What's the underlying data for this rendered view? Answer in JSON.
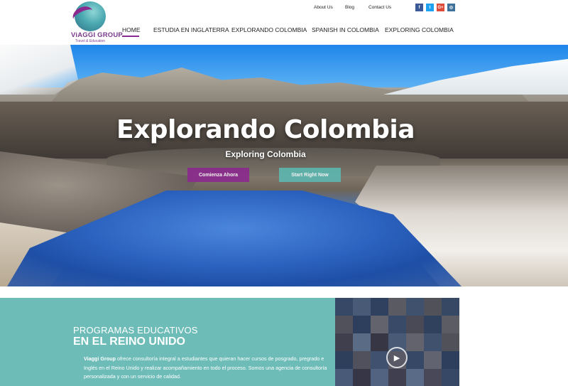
{
  "brand": {
    "name": "ViAGGI GROUP",
    "tagline": "Travel & Education"
  },
  "top_links": [
    "About Us",
    "Blog",
    "Contact Us"
  ],
  "social": [
    {
      "icon": "facebook-icon",
      "glyph": "f",
      "color": "#3b5998"
    },
    {
      "icon": "twitter-icon",
      "glyph": "t",
      "color": "#1da1f2"
    },
    {
      "icon": "google-plus-icon",
      "glyph": "G+",
      "color": "#dd4b39"
    },
    {
      "icon": "instagram-icon",
      "glyph": "◎",
      "color": "#3f729b"
    }
  ],
  "nav": [
    "HOME",
    "ESTUDIA EN INGLATERRA",
    "EXPLORANDO COLOMBIA",
    "SPANISH IN COLOMBIA",
    "EXPLORING COLOMBIA"
  ],
  "nav_active": "HOME",
  "hero": {
    "title": "Explorando Colombia",
    "subtitle": "Exploring Colombia",
    "button_primary": "Comienza Ahora",
    "button_secondary": "Start Right Now"
  },
  "section": {
    "heading_line1": "PROGRAMAS EDUCATIVOS",
    "heading_line2": "EN EL REINO UNIDO",
    "body_brand": "Viaggi Group",
    "body_text": " ofrece consultoría integral a estudiantes que quieran hacer cursos de posgrado, pregrado e Inglés en el Reino Unido y realizar acompañamiento en todo el proceso. Somos una agencia de consultoría personalizada y con un servicio de calidad."
  },
  "colors": {
    "purple": "#8b2a8e",
    "teal": "#6dbcb8",
    "button_teal": "#5db7b1"
  }
}
